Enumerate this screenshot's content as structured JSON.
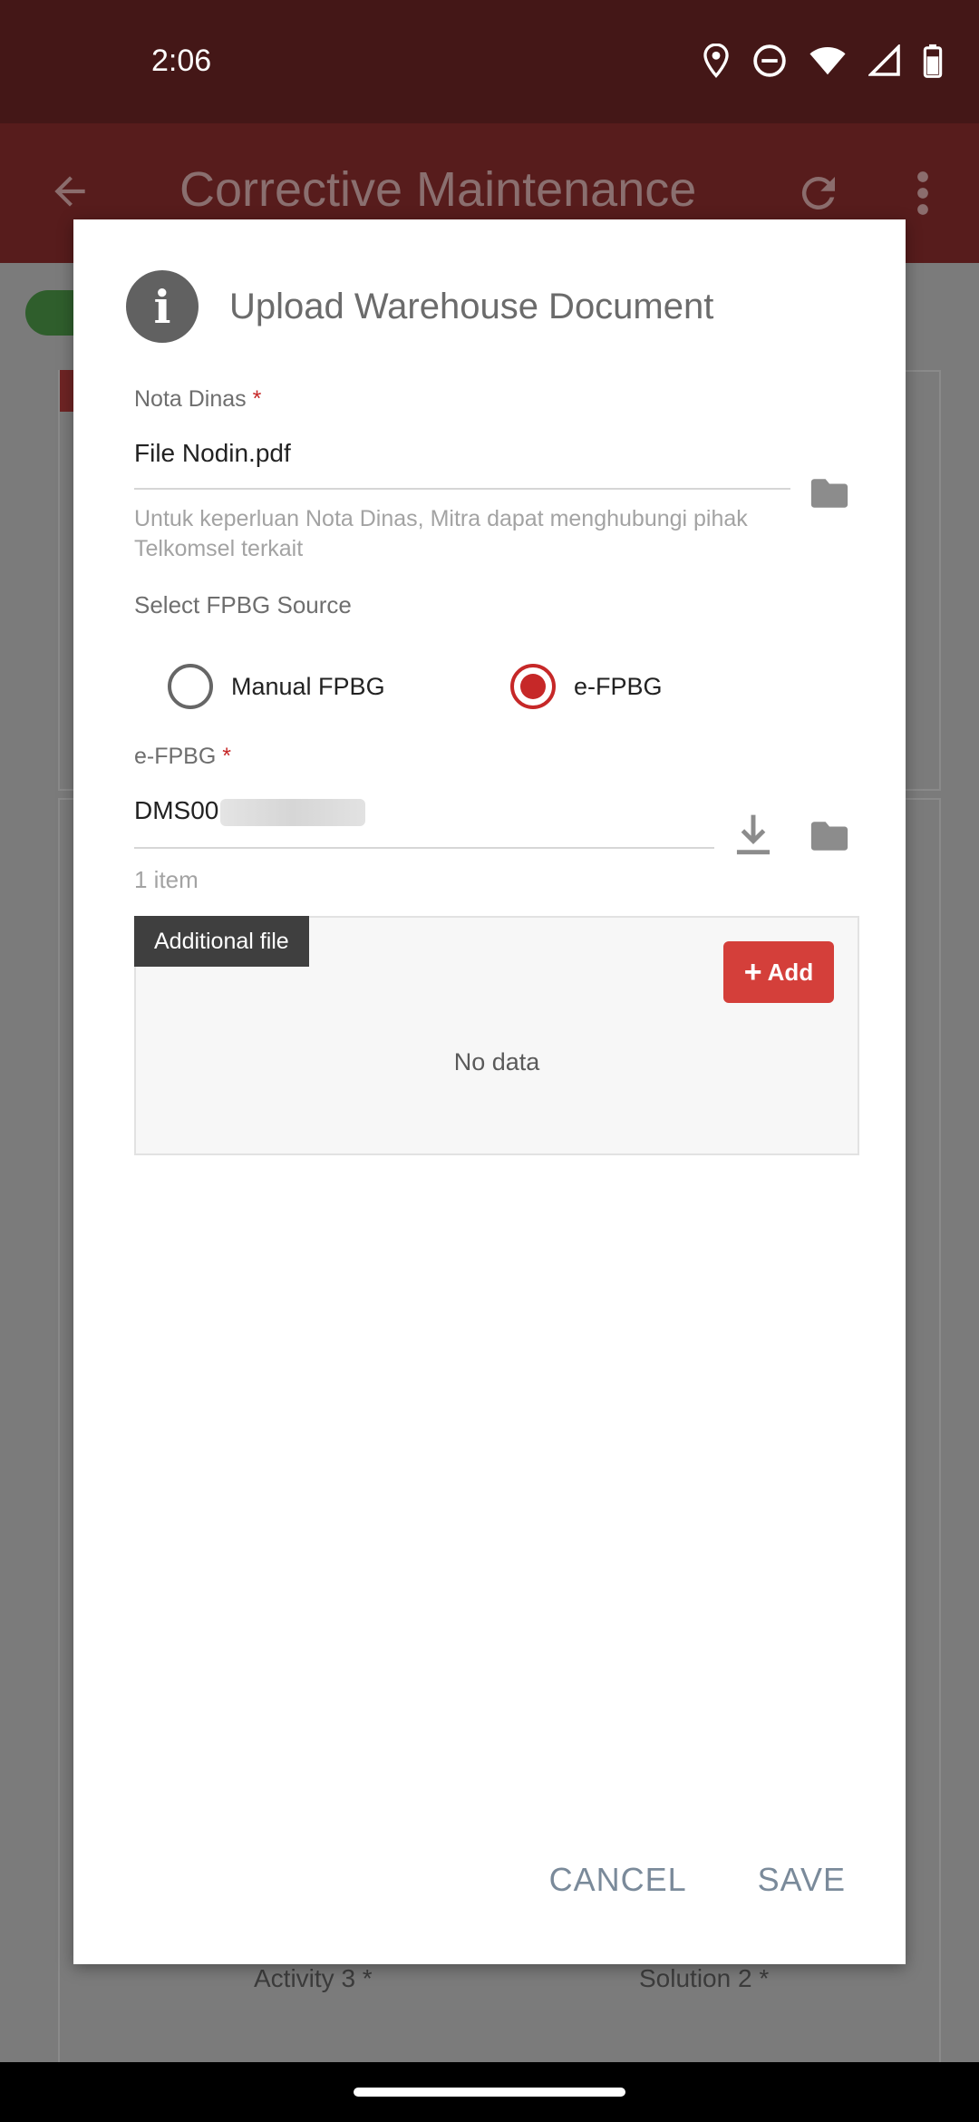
{
  "status_bar": {
    "time": "2:06",
    "icons": [
      "location-icon",
      "do-not-disturb-icon",
      "wifi-icon",
      "signal-icon",
      "battery-icon"
    ]
  },
  "app_bar": {
    "title": "Corrective Maintenance",
    "icons": [
      "back-arrow-icon",
      "refresh-icon",
      "more-vert-icon"
    ]
  },
  "background": {
    "labels": [
      "Activity 3 *",
      "Solution 2 *"
    ]
  },
  "dialog": {
    "title": "Upload Warehouse Document",
    "icon": "info-icon",
    "nota_dinas": {
      "label": "Nota Dinas",
      "required_mark": "*",
      "value": "File Nodin.pdf",
      "helper": "Untuk keperluan Nota Dinas, Mitra dapat menghubungi pihak Telkomsel terkait"
    },
    "fpbg_source": {
      "label": "Select FPBG Source",
      "options": [
        {
          "label": "Manual FPBG",
          "selected": false
        },
        {
          "label": "e-FPBG",
          "selected": true
        }
      ]
    },
    "efpbg": {
      "label": "e-FPBG",
      "required_mark": "*",
      "value_visible_prefix": "DMS00",
      "count_text": "1 item"
    },
    "additional_file": {
      "tag": "Additional file",
      "add_label": "Add",
      "empty_text": "No data"
    },
    "actions": {
      "cancel": "CANCEL",
      "save": "SAVE"
    }
  },
  "colors": {
    "accent_red": "#c62828",
    "add_button": "#d43f3a",
    "status_bar": "#441717",
    "app_bar": "#571c1c"
  }
}
